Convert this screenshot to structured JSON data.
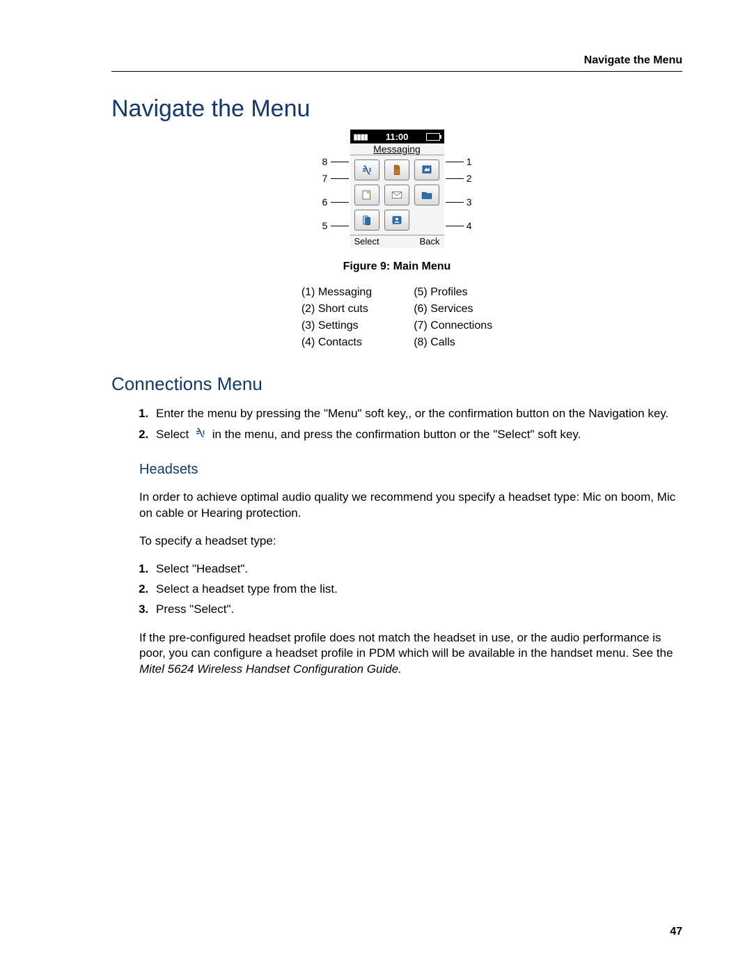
{
  "runningHeader": "Navigate the Menu",
  "h1": "Navigate the Menu",
  "phone": {
    "time": "11:00",
    "title": "Messaging",
    "softLeft": "Select",
    "softRight": "Back",
    "labels": {
      "n1": "1",
      "n2": "2",
      "n3": "3",
      "n4": "4",
      "n5": "5",
      "n6": "6",
      "n7": "7",
      "n8": "8"
    }
  },
  "figureCaption": "Figure 9: Main Menu",
  "legend": {
    "l1": "(1) Messaging",
    "l2": "(2) Short cuts",
    "l3": "(3) Settings",
    "l4": "(4) Contacts",
    "l5": "(5) Profiles",
    "l6": "(6) Services",
    "l7": "(7) Connections",
    "l8": "(8) Calls"
  },
  "h2": "Connections Menu",
  "conn": {
    "step1": "Enter the menu by pressing the \"Menu\" soft key,, or the confirmation button on the Navigation key.",
    "step2a": "Select ",
    "step2b": " in the menu, and press the confirmation button or the \"Select\" soft key."
  },
  "h3": "Headsets",
  "headsets": {
    "p1": "In order to achieve optimal audio quality we recommend you specify a headset type: Mic on boom, Mic on cable or Hearing protection.",
    "p2": "To specify a headset type:",
    "s1": "Select \"Headset\".",
    "s2": "Select a headset type from the list.",
    "s3": "Press \"Select\".",
    "p3a": "If the pre-configured headset profile does not match the headset in use, or the audio performance is poor, you can configure a headset profile in PDM which will be available in the handset menu. See the ",
    "p3b": "Mitel 5624 Wireless Handset Configuration Guide."
  },
  "pageNumber": "47"
}
